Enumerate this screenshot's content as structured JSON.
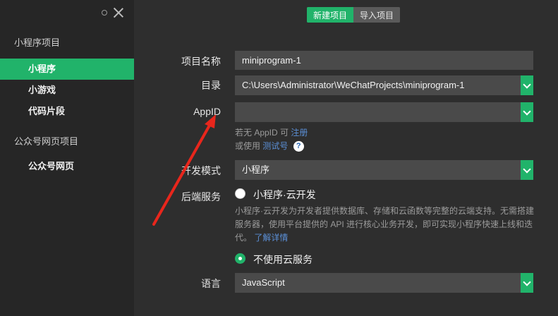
{
  "window": {
    "minimize_icon": "circle-icon",
    "close_icon": "close-icon"
  },
  "sidebar": {
    "section1": "小程序项目",
    "items1": [
      {
        "label": "小程序",
        "active": true
      },
      {
        "label": "小游戏",
        "active": false
      },
      {
        "label": "代码片段",
        "active": false
      }
    ],
    "section2": "公众号网页项目",
    "items2": [
      {
        "label": "公众号网页",
        "active": false
      }
    ]
  },
  "tabs": {
    "new_project": "新建项目",
    "import_project": "导入项目"
  },
  "form": {
    "name_label": "项目名称",
    "name_value": "miniprogram-1",
    "dir_label": "目录",
    "dir_value": "C:\\Users\\Administrator\\WeChatProjects\\miniprogram-1",
    "appid_label": "AppID",
    "appid_value": "",
    "appid_hint_prefix": "若无 AppID 可",
    "appid_hint_link": "注册",
    "appid_hint2_prefix": "或使用",
    "appid_hint2_link": "测试号",
    "help_glyph": "?",
    "mode_label": "开发模式",
    "mode_value": "小程序",
    "backend_label": "后端服务",
    "cloud_option": "小程序·云开发",
    "cloud_desc": "小程序·云开发为开发者提供数据库、存储和云函数等完整的云端支持。无需搭建服务器，使用平台提供的 API 进行核心业务开发，即可实现小程序快速上线和迭代。",
    "cloud_more": "了解详情",
    "no_cloud_option": "不使用云服务",
    "lang_label": "语言",
    "lang_value": "JavaScript"
  },
  "colors": {
    "accent": "#21b36a",
    "annotation_arrow": "#e8261c"
  }
}
